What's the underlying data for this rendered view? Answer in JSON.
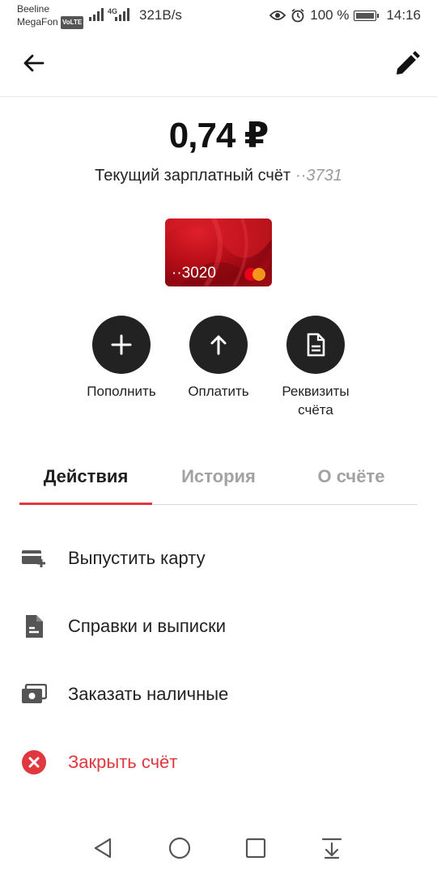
{
  "status_bar": {
    "carrier1": "Beeline",
    "carrier2": "MegaFon",
    "volte": "VoLTE",
    "network_type": "4G",
    "speed": "321B/s",
    "battery": "100 %",
    "time": "14:16"
  },
  "header": {
    "back_icon": "arrow-left-icon",
    "edit_icon": "pencil-icon"
  },
  "account": {
    "balance": "0,74 ₽",
    "title": "Текущий зарплатный счёт",
    "mask": "··3731"
  },
  "card": {
    "number": "··3020",
    "brand_icon": "mastercard-icon"
  },
  "actions": [
    {
      "label": "Пополнить",
      "icon": "plus-icon"
    },
    {
      "label": "Оплатить",
      "icon": "arrow-up-icon"
    },
    {
      "label": "Реквизиты счёта",
      "icon": "document-icon"
    }
  ],
  "tabs": [
    {
      "label": "Действия",
      "active": true
    },
    {
      "label": "История",
      "active": false
    },
    {
      "label": "О счёте",
      "active": false
    }
  ],
  "menu": [
    {
      "label": "Выпустить карту",
      "icon": "add-card-icon"
    },
    {
      "label": "Справки и выписки",
      "icon": "document-icon"
    },
    {
      "label": "Заказать наличные",
      "icon": "cash-icon"
    },
    {
      "label": "Закрыть счёт",
      "icon": "close-circle-icon"
    }
  ],
  "colors": {
    "accent": "#e0383e",
    "dark": "#222222",
    "muted": "#a2a2a2"
  }
}
